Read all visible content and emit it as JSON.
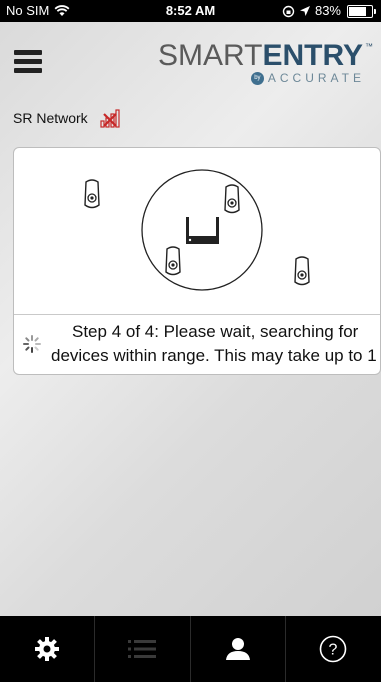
{
  "status_bar": {
    "carrier": "No SIM",
    "time": "8:52 AM",
    "battery": "83%",
    "battery_level": 0.83,
    "icons": [
      "wifi-icon",
      "orientation-lock-icon",
      "location-arrow-icon",
      "battery-icon"
    ]
  },
  "header": {
    "menu_icon": "hamburger-menu-icon",
    "brand": {
      "smart": "SMART",
      "entry": "ENTRY",
      "tm": "™",
      "by": "by",
      "accurate": "ACCURATE"
    }
  },
  "network": {
    "label": "SR Network",
    "icon": "signal-bars-disconnected-icon"
  },
  "search_card": {
    "step_line1": "Step 4 of 4: Please wait, searching for",
    "step_line2": "devices within range. This may take up to 1",
    "icons": [
      "lock-icon",
      "router-icon",
      "range-circle",
      "loading-spinner-icon"
    ]
  },
  "tab_bar": {
    "tabs": [
      {
        "name": "settings",
        "icon": "gear-icon"
      },
      {
        "name": "list",
        "icon": "list-icon"
      },
      {
        "name": "user",
        "icon": "user-icon"
      },
      {
        "name": "help",
        "icon": "help-icon",
        "label": "?"
      }
    ]
  },
  "colors": {
    "brand_gray": "#5a5a5a",
    "brand_blue": "#2b4f6b",
    "signal_red": "#c62828",
    "tab_bar_bg": "#000000"
  }
}
